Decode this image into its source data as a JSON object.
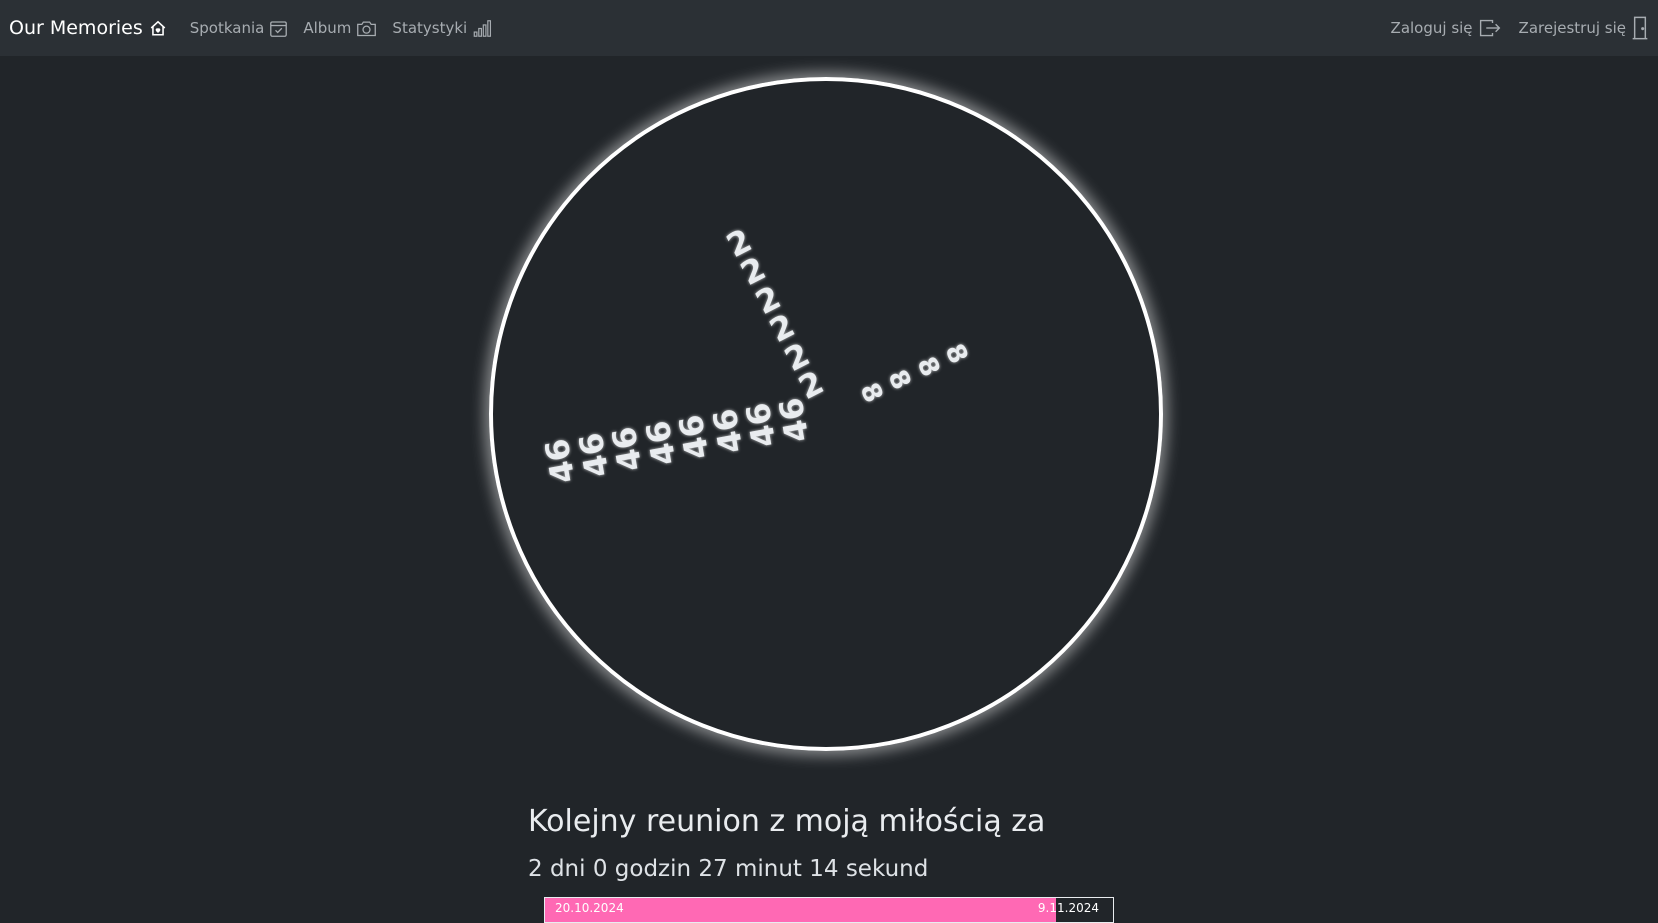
{
  "navbar": {
    "brand": "Our Memories",
    "links": {
      "meetings": "Spotkania",
      "album": "Album",
      "stats": "Statystyki"
    },
    "login": "Zaloguj się",
    "register": "Zarejestruj się"
  },
  "clock": {
    "hour_hand": [
      "2",
      "2",
      "2",
      "2",
      "2",
      "2"
    ],
    "minute_hand": [
      "46",
      "46",
      "46",
      "46",
      "46",
      "46",
      "46",
      "46"
    ],
    "second_hand": [
      "8",
      "8",
      "8",
      "8"
    ]
  },
  "countdown": {
    "title": "Kolejny reunion z moją miłością za",
    "remaining": "2 dni 0 godzin 27 minut 14 sekund"
  },
  "progress": {
    "start_date": "20.10.2024",
    "end_date": "9.11.2024",
    "fraction": 0.9,
    "fill_color": "#ff69b4"
  },
  "colors": {
    "background": "#212529",
    "navbar": "#2b3035",
    "clock_border": "#ffffff"
  }
}
